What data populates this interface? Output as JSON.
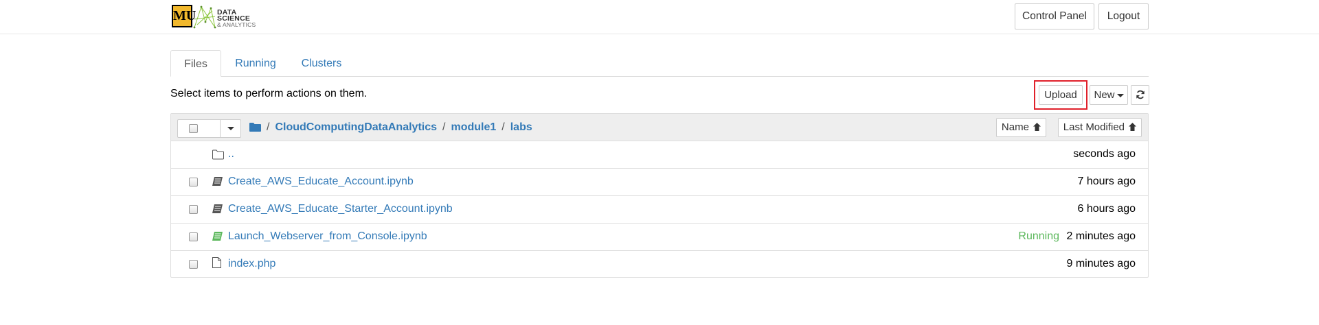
{
  "header": {
    "logo_mark": "MU",
    "logo_line1": "DATA SCIENCE",
    "logo_line2": "& ANALYTICS",
    "control_panel_label": "Control Panel",
    "logout_label": "Logout"
  },
  "tabs": [
    {
      "label": "Files",
      "active": true
    },
    {
      "label": "Running",
      "active": false
    },
    {
      "label": "Clusters",
      "active": false
    }
  ],
  "toolbar": {
    "info_text": "Select items to perform actions on them.",
    "upload_label": "Upload",
    "new_label": "New",
    "refresh_icon": "refresh-icon"
  },
  "breadcrumb": {
    "root_icon": "folder-icon",
    "parts": [
      "CloudComputingDataAnalytics",
      "module1",
      "labs"
    ],
    "separator": "/"
  },
  "list_header": {
    "sort_name_label": "Name",
    "sort_modified_label": "Last Modified",
    "sort_arrow": "🡡"
  },
  "files": [
    {
      "name": "..",
      "type": "parent-folder",
      "status": "",
      "modified": "seconds ago",
      "checkbox": false
    },
    {
      "name": "Create_AWS_Educate_Account.ipynb",
      "type": "notebook",
      "status": "",
      "modified": "7 hours ago",
      "checkbox": true
    },
    {
      "name": "Create_AWS_Educate_Starter_Account.ipynb",
      "type": "notebook",
      "status": "",
      "modified": "6 hours ago",
      "checkbox": true
    },
    {
      "name": "Launch_Webserver_from_Console.ipynb",
      "type": "notebook-running",
      "status": "Running",
      "modified": "2 minutes ago",
      "checkbox": true
    },
    {
      "name": "index.php",
      "type": "file",
      "status": "",
      "modified": "9 minutes ago",
      "checkbox": true
    }
  ],
  "colors": {
    "link": "#337ab7",
    "running": "#5cb85c",
    "highlight": "#e0202a",
    "logo_gold": "#f1b82d"
  }
}
